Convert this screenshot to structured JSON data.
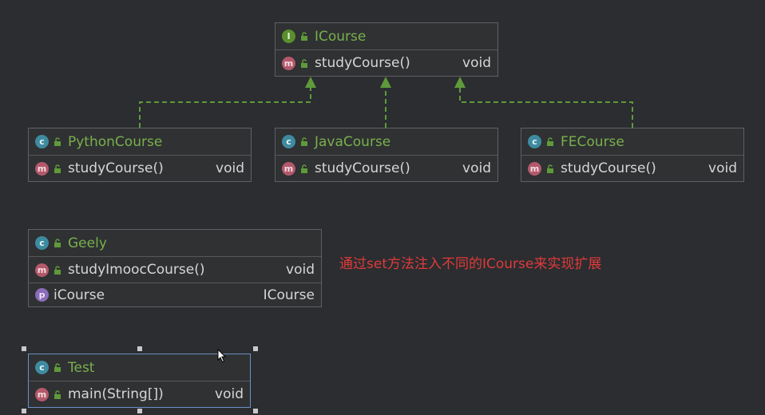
{
  "diagram": {
    "interface": {
      "name": "ICourse",
      "badge": "I",
      "methods": [
        {
          "badge": "m",
          "name": "studyCourse()",
          "type": "void"
        }
      ]
    },
    "implementations": [
      {
        "name": "PythonCourse",
        "badge": "c",
        "method": "studyCourse()",
        "method_badge": "m",
        "type": "void"
      },
      {
        "name": "JavaCourse",
        "badge": "c",
        "method": "studyCourse()",
        "method_badge": "m",
        "type": "void"
      },
      {
        "name": "FECourse",
        "badge": "c",
        "method": "studyCourse()",
        "method_badge": "m",
        "type": "void"
      }
    ],
    "geely": {
      "name": "Geely",
      "badge": "c",
      "method": {
        "badge": "m",
        "name": "studyImoocCourse()",
        "type": "void"
      },
      "field": {
        "badge": "p",
        "name": "iCourse",
        "type": "ICourse"
      }
    },
    "test": {
      "name": "Test",
      "badge": "c",
      "method": {
        "badge": "m",
        "name": "main(String[])",
        "type": "void"
      }
    },
    "note": "通过set方法注入不同的ICourse来实现扩展"
  },
  "colors": {
    "background": "#2b2d30",
    "class_name": "#79b04b",
    "arrow": "#5f9a3a",
    "note": "#e03a3a"
  }
}
